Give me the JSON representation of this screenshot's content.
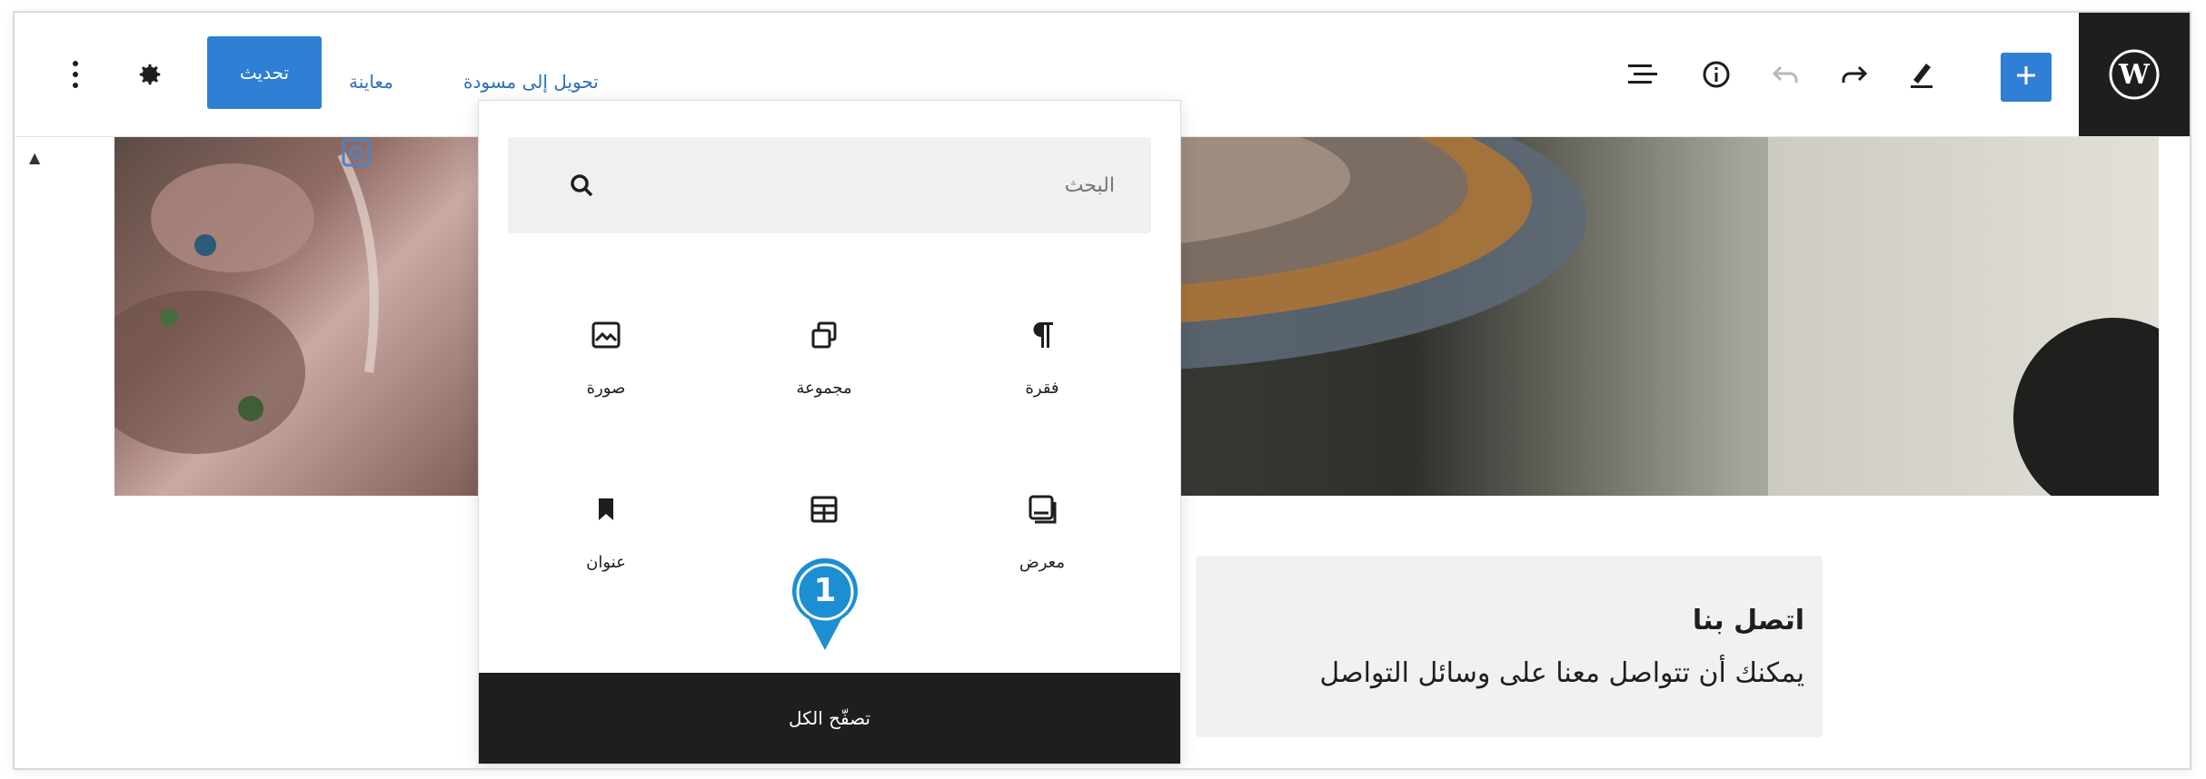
{
  "toolbar": {
    "update_label": "تحديث",
    "preview_label": "معاينة",
    "switch_to_draft_label": "تحويل إلى مسودة",
    "icons": [
      "more-vertical-icon",
      "gear-icon",
      "list-view-icon",
      "info-icon",
      "undo-icon",
      "redo-icon",
      "pen-tool-icon",
      "plus-icon",
      "wordpress-logo"
    ]
  },
  "inserter": {
    "search_placeholder": "البحث",
    "blocks": [
      {
        "label": "فقرة",
        "icon": "paragraph-icon"
      },
      {
        "label": "مجموعة",
        "icon": "group-icon"
      },
      {
        "label": "صورة",
        "icon": "image-icon"
      },
      {
        "label": "معرض",
        "icon": "gallery-icon"
      },
      {
        "label": "",
        "icon": "table-icon"
      },
      {
        "label": "عنوان",
        "icon": "bookmark-icon"
      }
    ],
    "browse_all_label": "تصفّح الكل"
  },
  "callout": {
    "number": "1"
  },
  "content": {
    "contact_title": "اتصل بنا",
    "contact_text": "يمكنك أن تتواصل معنا على وسائل التواصل"
  },
  "colors": {
    "accent": "#2f7fd4",
    "dark": "#1e1e1e",
    "callout": "#1b8fd1"
  }
}
